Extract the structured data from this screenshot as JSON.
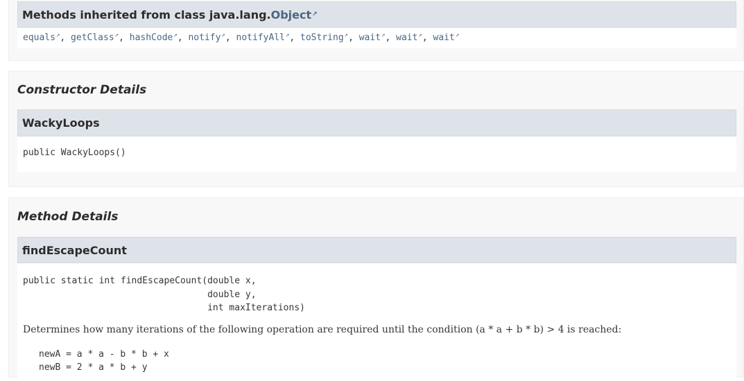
{
  "inherited": {
    "heading_prefix": "Methods inherited from class java.lang.",
    "heading_link": "Object",
    "methods": [
      "equals",
      "getClass",
      "hashCode",
      "notify",
      "notifyAll",
      "toString",
      "wait",
      "wait",
      "wait"
    ]
  },
  "constructor": {
    "section_title": "Constructor Details",
    "name": "WackyLoops",
    "signature": "public WackyLoops()"
  },
  "method": {
    "section_title": "Method Details",
    "name": "findEscapeCount",
    "signature_line1": "public static int findEscapeCount(double x,",
    "signature_line2": "                                  double y,",
    "signature_line3": "                                  int maxIterations)",
    "description": "Determines how many iterations of the following operation are required until the condition (a * a + b * b) > 4 is reached:",
    "code_line1": "newA = a * a - b * b + x",
    "code_line2": "newB = 2 * a * b + y"
  }
}
